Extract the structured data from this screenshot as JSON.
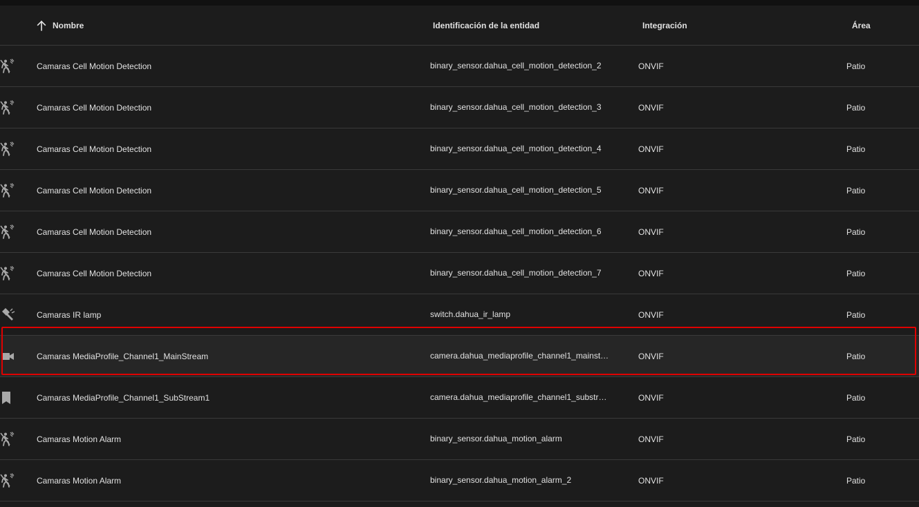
{
  "header": {
    "name_label": "Nombre",
    "entity_id_label": "Identificación de la entidad",
    "integration_label": "Integración",
    "area_label": "Área"
  },
  "rows": [
    {
      "icon": "motion-sensor-off-icon",
      "name": "Camaras Cell Motion Detection",
      "entity_id": "binary_sensor.dahua_cell_motion_detection_2",
      "integration": "ONVIF",
      "area": "Patio"
    },
    {
      "icon": "motion-sensor-off-icon",
      "name": "Camaras Cell Motion Detection",
      "entity_id": "binary_sensor.dahua_cell_motion_detection_3",
      "integration": "ONVIF",
      "area": "Patio"
    },
    {
      "icon": "motion-sensor-off-icon",
      "name": "Camaras Cell Motion Detection",
      "entity_id": "binary_sensor.dahua_cell_motion_detection_4",
      "integration": "ONVIF",
      "area": "Patio"
    },
    {
      "icon": "motion-sensor-off-icon",
      "name": "Camaras Cell Motion Detection",
      "entity_id": "binary_sensor.dahua_cell_motion_detection_5",
      "integration": "ONVIF",
      "area": "Patio"
    },
    {
      "icon": "motion-sensor-off-icon",
      "name": "Camaras Cell Motion Detection",
      "entity_id": "binary_sensor.dahua_cell_motion_detection_6",
      "integration": "ONVIF",
      "area": "Patio"
    },
    {
      "icon": "motion-sensor-off-icon",
      "name": "Camaras Cell Motion Detection",
      "entity_id": "binary_sensor.dahua_cell_motion_detection_7",
      "integration": "ONVIF",
      "area": "Patio"
    },
    {
      "icon": "flashlight-icon",
      "name": "Camaras IR lamp",
      "entity_id": "switch.dahua_ir_lamp",
      "integration": "ONVIF",
      "area": "Patio"
    },
    {
      "icon": "video-camera-icon",
      "name": "Camaras MediaProfile_Channel1_MainStream",
      "entity_id": "camera.dahua_mediaprofile_channel1_mainst…",
      "integration": "ONVIF",
      "area": "Patio",
      "highlighted": true
    },
    {
      "icon": "bookmark-icon",
      "name": "Camaras MediaProfile_Channel1_SubStream1",
      "entity_id": "camera.dahua_mediaprofile_channel1_substr…",
      "integration": "ONVIF",
      "area": "Patio"
    },
    {
      "icon": "motion-sensor-off-icon",
      "name": "Camaras Motion Alarm",
      "entity_id": "binary_sensor.dahua_motion_alarm",
      "integration": "ONVIF",
      "area": "Patio"
    },
    {
      "icon": "motion-sensor-off-icon",
      "name": "Camaras Motion Alarm",
      "entity_id": "binary_sensor.dahua_motion_alarm_2",
      "integration": "ONVIF",
      "area": "Patio"
    }
  ],
  "colors": {
    "background": "#1c1c1c",
    "row_highlight": "#262626",
    "highlight_border": "#e00000",
    "text": "#e1e1e1",
    "icon": "#a8a8a8",
    "divider": "#3a3a3a"
  }
}
